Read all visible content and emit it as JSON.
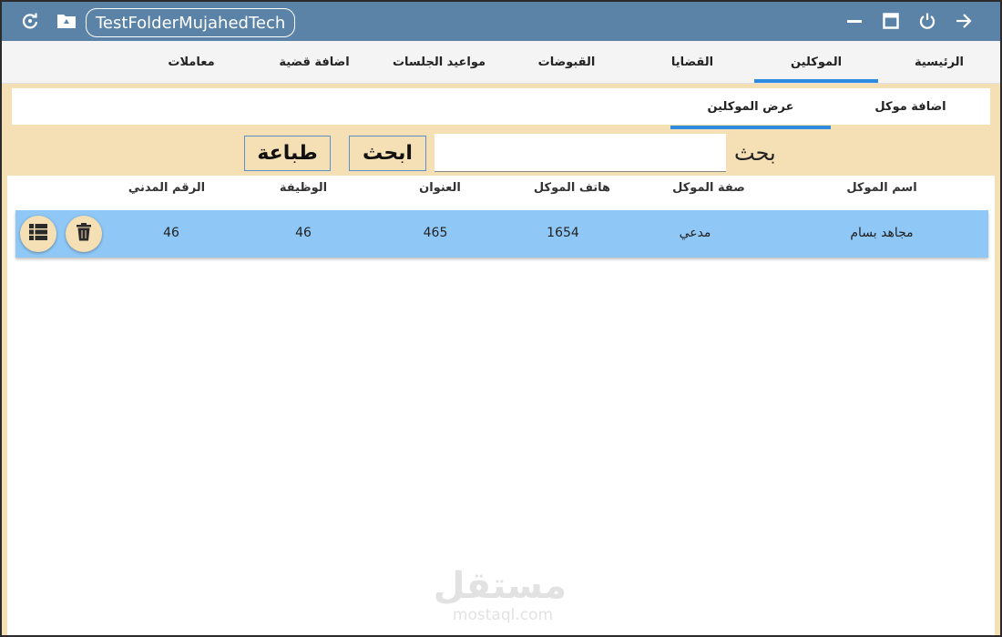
{
  "titlebar": {
    "title": "TestFolderMujahedTech",
    "icons": [
      "refresh-icon",
      "drive-folder-icon",
      "minimize-icon",
      "maximize-icon",
      "power-icon",
      "arrow-right-icon"
    ],
    "color": "#5b83a8"
  },
  "mainnav": {
    "tabs": [
      {
        "label": "الرئيسية",
        "active": false
      },
      {
        "label": "الموكلين",
        "active": true
      },
      {
        "label": "القضايا",
        "active": false
      },
      {
        "label": "القبوضات",
        "active": false
      },
      {
        "label": "مواعيد الجلسات",
        "active": false
      },
      {
        "label": "اضافة قضية",
        "active": false
      },
      {
        "label": "معاملات",
        "active": false
      }
    ],
    "accent": "#2f8be0"
  },
  "subnav": {
    "tabs": [
      {
        "label": "اضافة موكل",
        "active": false
      },
      {
        "label": "عرض الموكلين",
        "active": true
      }
    ]
  },
  "search": {
    "label": "بحث",
    "value": "",
    "search_button": "ابحث",
    "print_button": "طباعة"
  },
  "table": {
    "columns": [
      "اسم الموكل",
      "صفة الموكل",
      "هاتف الموكل",
      "العنوان",
      "الوظيفة",
      "الرقم المدني"
    ],
    "rows": [
      {
        "name": "مجاهد بسام",
        "role": "مدعي",
        "phone": "1654",
        "address": "465",
        "job": "46",
        "civil_id": "46"
      }
    ],
    "row_actions": [
      "delete-icon",
      "details-list-icon"
    ],
    "row_color": "#8fc8f6"
  },
  "background": "#f5dfb5",
  "watermark": {
    "arabic": "مستقل",
    "latin": "mostaql.com"
  }
}
